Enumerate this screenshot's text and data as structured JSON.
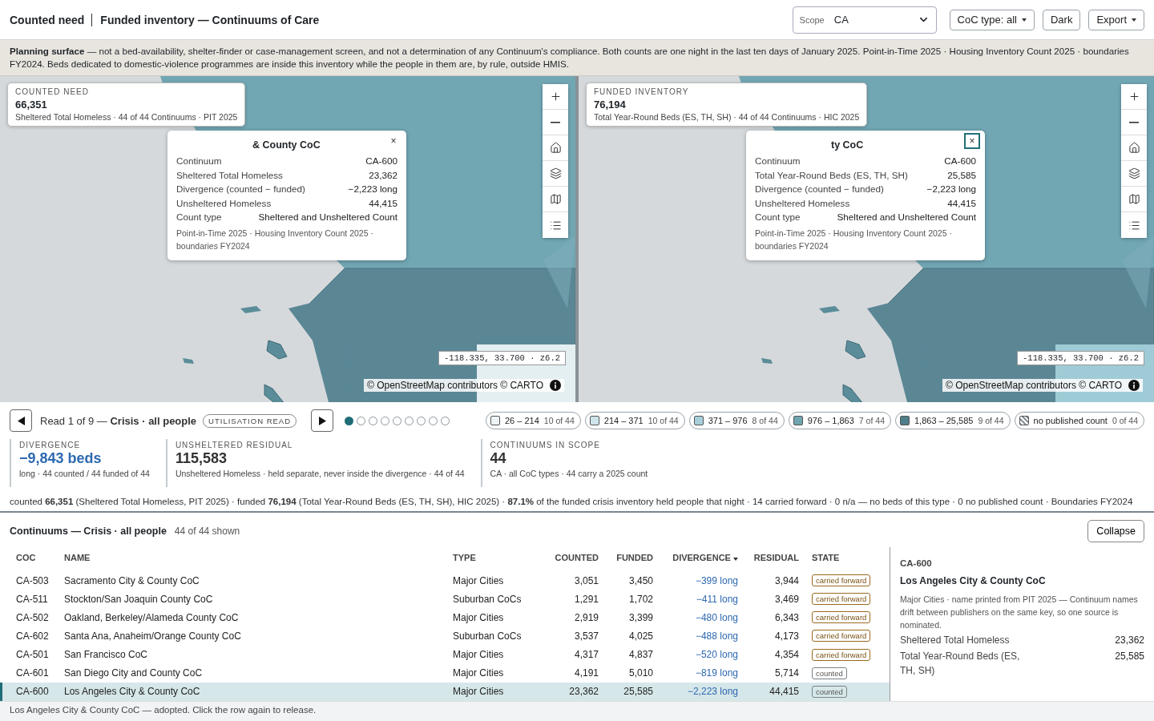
{
  "header": {
    "title_primary": "Counted need",
    "title_secondary": "Funded inventory — Continuums of Care",
    "scope": {
      "label": "Scope",
      "value": "CA"
    },
    "buttons": [
      {
        "label": "CoC type: all",
        "caret": true
      },
      {
        "label": "Dark",
        "caret": false
      },
      {
        "label": "Export",
        "caret": true
      }
    ]
  },
  "notice": "**Planning surface** — not a bed-availability, shelter-finder or case-management screen, and not a determination of any Continuum's compliance. Both counts are one night in the last ten days of January 2025. Point-in-Time 2025 · Housing Inventory Count 2025 · boundaries FY2024. Beds dedicated to domestic-violence programmes are inside this inventory while the people in them are, by rule, outside HMIS.",
  "maps": [
    {
      "stat": {
        "label": "COUNTED NEED",
        "value": "66,351",
        "note": "Sheltered Total Homeless · 44 of 44 Continuums · PIT 2025"
      },
      "popup": {
        "title": "& County CoC",
        "close": "×",
        "close_focused": false,
        "rows": [
          {
            "label": "Continuum",
            "value": "CA-600"
          },
          {
            "label": "Sheltered Total Homeless",
            "value": "23,362"
          },
          {
            "label": "Divergence (counted − funded)",
            "value": "−2,223 long"
          },
          {
            "label": "Unsheltered Homeless",
            "value": "44,415"
          },
          {
            "label": "Count type",
            "value": "Sheltered and Unsheltered Count"
          }
        ],
        "source": "Point-in-Time 2025 · Housing Inventory Count 2025 · boundaries FY2024"
      },
      "coords": "-118.335, 33.700 · z6.2",
      "attribution": "© OpenStreetMap contributors © CARTO"
    },
    {
      "stat": {
        "label": "FUNDED INVENTORY",
        "value": "76,194",
        "note": "Total Year-Round Beds (ES, TH, SH) · 44 of 44 Continuums · HIC 2025"
      },
      "popup": {
        "title": "ty CoC",
        "close": "×",
        "close_focused": true,
        "rows": [
          {
            "label": "Continuum",
            "value": "CA-600"
          },
          {
            "label": "Total Year-Round Beds (ES, TH, SH)",
            "value": "25,585"
          },
          {
            "label": "Divergence (counted − funded)",
            "value": "−2,223 long"
          },
          {
            "label": "Unsheltered Homeless",
            "value": "44,415"
          },
          {
            "label": "Count type",
            "value": "Sheltered and Unsheltered Count"
          }
        ],
        "source": "Point-in-Time 2025 · Housing Inventory Count 2025 · boundaries FY2024"
      },
      "coords": "-118.335, 33.700 · z6.2",
      "attribution": "© OpenStreetMap contributors © CARTO"
    }
  ],
  "reader": {
    "text": "Read 1 of 9 — **Crisis · all people**",
    "badge": "UTILISATION READ",
    "pages": [
      {
        "selected": true
      },
      {
        "selected": false
      },
      {
        "selected": false
      },
      {
        "selected": false
      },
      {
        "selected": false
      },
      {
        "selected": false
      },
      {
        "selected": false
      },
      {
        "selected": false
      },
      {
        "selected": false
      }
    ]
  },
  "legend": [
    {
      "label": "26 – 214",
      "count": "10 of 44",
      "kind": "fill",
      "color": "#eef4f6"
    },
    {
      "label": "214 – 371",
      "count": "10 of 44",
      "kind": "fill",
      "color": "#cfe4eb"
    },
    {
      "label": "371 – 976",
      "count": "8 of 44",
      "kind": "fill",
      "color": "#a6cfda"
    },
    {
      "label": "976 – 1,863",
      "count": "7 of 44",
      "kind": "fill",
      "color": "#6fa4b1"
    },
    {
      "label": "1,863 – 25,585",
      "count": "9 of 44",
      "kind": "fill",
      "color": "#4e7e8b"
    },
    {
      "label": "no published count",
      "count": "0 of 44",
      "kind": "hatch",
      "color": "#8c9499"
    }
  ],
  "stats": [
    {
      "label": "DIVERGENCE",
      "value": "−9,843 beds",
      "note": "long · 44 counted / 44 funded of 44",
      "accent": true
    },
    {
      "label": "UNSHELTERED RESIDUAL",
      "value": "115,583",
      "note": "Unsheltered Homeless · held separate, never inside the divergence · 44 of 44",
      "accent": false
    },
    {
      "label": "CONTINUUMS IN SCOPE",
      "value": "44",
      "note": "CA · all CoC types · 44 carry a 2025 count",
      "accent": false
    }
  ],
  "summary": "counted **66,351** (Sheltered Total Homeless, PIT 2025) · funded **76,194** (Total Year-Round Beds (ES, TH, SH), HIC 2025) · **87.1%** of the funded crisis inventory held people that night · 14 carried forward · 0 n/a — no beds of this type · 0 no published count · Boundaries FY2024",
  "table": {
    "title": "Continuums — Crisis · all people",
    "count": "44 of 44 shown",
    "collapse": "Collapse",
    "columns": [
      {
        "label": "COC",
        "sorted": false
      },
      {
        "label": "NAME",
        "sorted": false
      },
      {
        "label": "TYPE",
        "sorted": false
      },
      {
        "label": "COUNTED",
        "sorted": false
      },
      {
        "label": "FUNDED",
        "sorted": false
      },
      {
        "label": "DIVERGENCE",
        "sorted": true
      },
      {
        "label": "RESIDUAL",
        "sorted": false
      },
      {
        "label": "STATE",
        "sorted": false
      }
    ],
    "rows": [
      {
        "coc": "CA-503",
        "name": "Sacramento City & County CoC",
        "type": "Major Cities",
        "counted": "3,051",
        "funded": "3,450",
        "divergence": "−399 long",
        "residual": "3,944",
        "state": "carried forward",
        "kind": "carried",
        "selected": false
      },
      {
        "coc": "CA-511",
        "name": "Stockton/San Joaquin County CoC",
        "type": "Suburban CoCs",
        "counted": "1,291",
        "funded": "1,702",
        "divergence": "−411 long",
        "residual": "3,469",
        "state": "carried forward",
        "kind": "carried",
        "selected": false
      },
      {
        "coc": "CA-502",
        "name": "Oakland, Berkeley/Alameda County CoC",
        "type": "Major Cities",
        "counted": "2,919",
        "funded": "3,399",
        "divergence": "−480 long",
        "residual": "6,343",
        "state": "carried forward",
        "kind": "carried",
        "selected": false
      },
      {
        "coc": "CA-602",
        "name": "Santa Ana, Anaheim/Orange County CoC",
        "type": "Suburban CoCs",
        "counted": "3,537",
        "funded": "4,025",
        "divergence": "−488 long",
        "residual": "4,173",
        "state": "carried forward",
        "kind": "carried",
        "selected": false
      },
      {
        "coc": "CA-501",
        "name": "San Francisco CoC",
        "type": "Major Cities",
        "counted": "4,317",
        "funded": "4,837",
        "divergence": "−520 long",
        "residual": "4,354",
        "state": "carried forward",
        "kind": "carried",
        "selected": false
      },
      {
        "coc": "CA-601",
        "name": "San Diego City and County CoC",
        "type": "Major Cities",
        "counted": "4,191",
        "funded": "5,010",
        "divergence": "−819 long",
        "residual": "5,714",
        "state": "counted",
        "kind": "counted",
        "selected": false
      },
      {
        "coc": "CA-600",
        "name": "Los Angeles City & County CoC",
        "type": "Major Cities",
        "counted": "23,362",
        "funded": "25,585",
        "divergence": "−2,223 long",
        "residual": "44,415",
        "state": "counted",
        "kind": "counted",
        "selected": true
      }
    ]
  },
  "detail": {
    "code": "CA-600",
    "name": "Los Angeles City & County CoC",
    "description": "Major Cities · name printed from PIT 2025 — Continuum names drift between publishers on the same key, so one source is nominated.",
    "rows": [
      {
        "label": "Sheltered Total Homeless",
        "value": "23,362"
      },
      {
        "label": "Total Year-Round Beds (ES, TH, SH)",
        "value": "25,585"
      }
    ]
  },
  "status": "Los Angeles City & County CoC — adopted. Click the row again to release."
}
